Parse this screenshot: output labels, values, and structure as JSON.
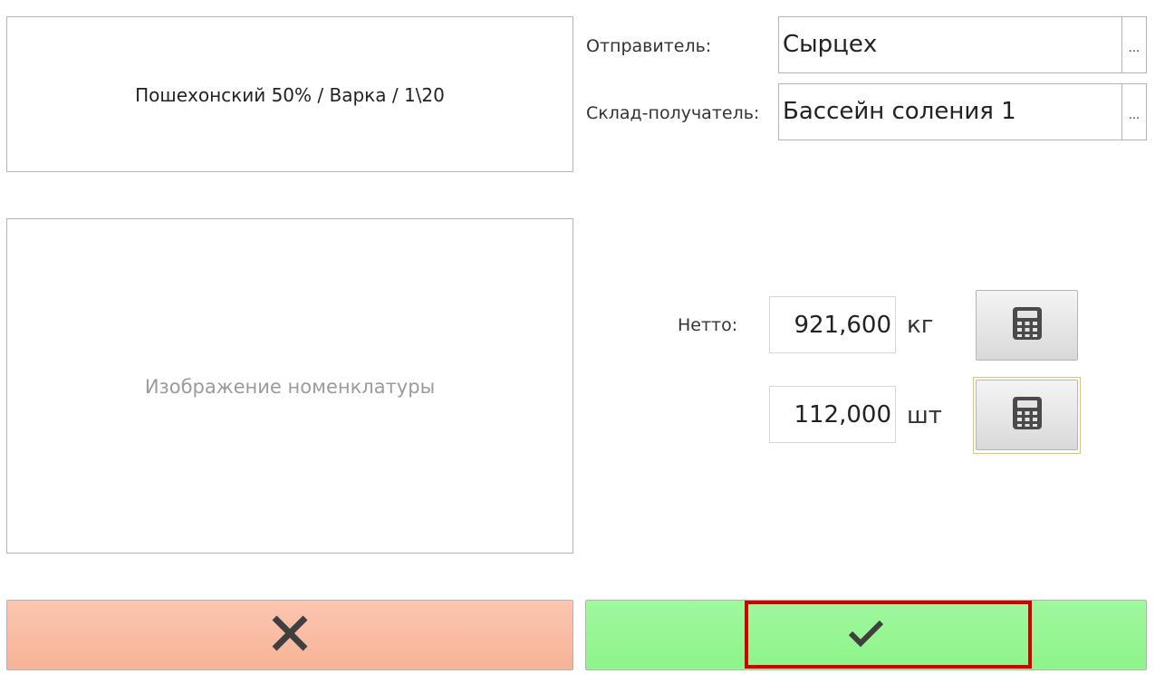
{
  "product": {
    "name": "Пошехонский 50% / Варка / 1\\20"
  },
  "image": {
    "placeholder": "Изображение номенклатуры"
  },
  "sender": {
    "label": "Отправитель:",
    "value": "Сырцех",
    "button": "..."
  },
  "receiver": {
    "label": "Склад-получатель:",
    "value": "Бассейн соления 1",
    "button": "..."
  },
  "net": {
    "label": "Нетто:",
    "weight_value": "921,600",
    "weight_unit": "кг",
    "count_value": "112,000",
    "count_unit": "шт"
  },
  "icons": {
    "calculator": "calculator-icon",
    "cancel": "close-icon",
    "confirm": "checkmark-icon"
  },
  "colors": {
    "cancel_bg": "#f8b99e",
    "confirm_bg": "#92f58f",
    "highlight": "#d40000",
    "focus": "#e6c55a"
  }
}
